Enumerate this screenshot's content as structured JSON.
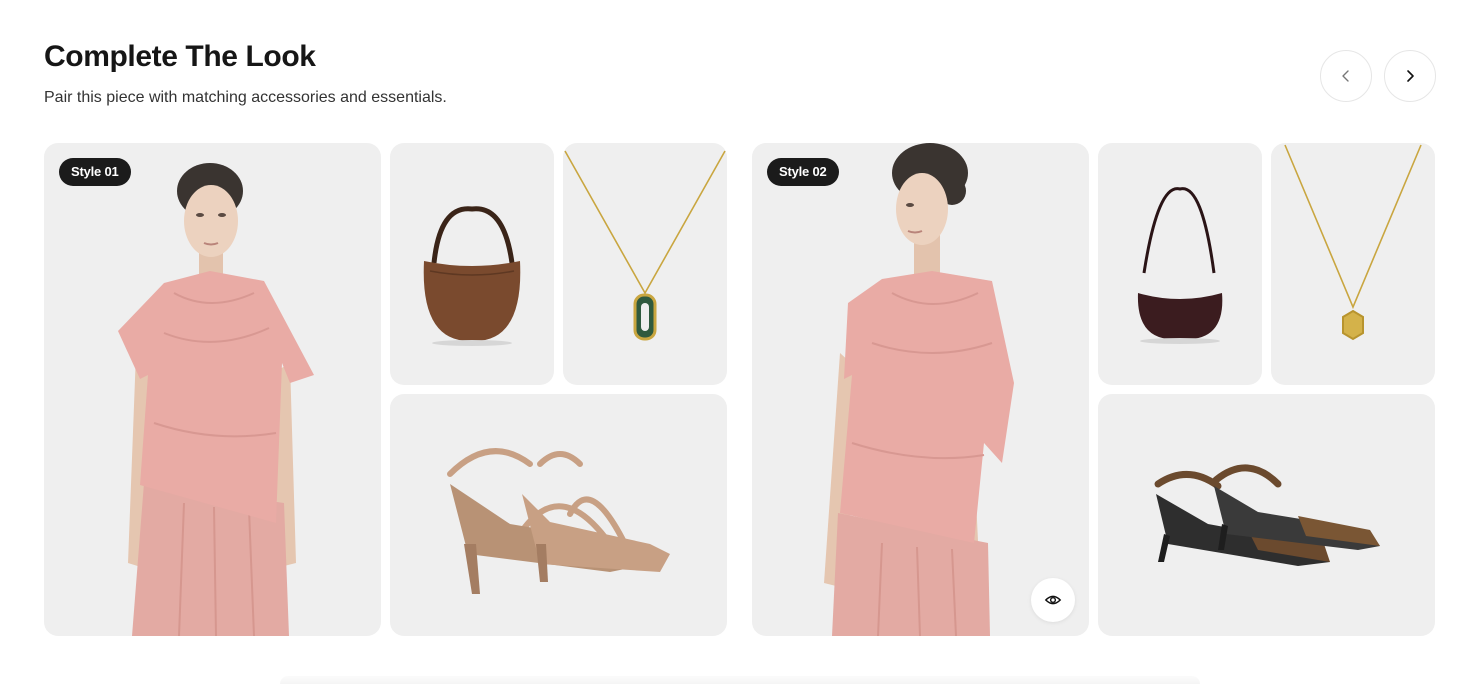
{
  "section": {
    "title": "Complete The Look",
    "subtitle": "Pair this piece with matching accessories and essentials."
  },
  "nav": {
    "prev_icon": "chevron-left-icon",
    "next_icon": "chevron-right-icon"
  },
  "looks": [
    {
      "badge": "Style 01",
      "model_view": "front",
      "bag_color": "#7a4a2e",
      "pendant_color": "#2f5a3e",
      "shoe_color": "#c8a084"
    },
    {
      "badge": "Style 02",
      "model_view": "three-quarter",
      "bag_color": "#3b1c1f",
      "pendant_color": "#d4b24a",
      "shoe_color": "#6b4a2e",
      "quick_view_icon": "eye-icon"
    }
  ],
  "colors": {
    "tile_bg": "#efefef",
    "badge_bg": "#1b1b1b",
    "top_color": "#e7a9a3",
    "skin": "#e9cdb8",
    "hair": "#3a3430"
  }
}
